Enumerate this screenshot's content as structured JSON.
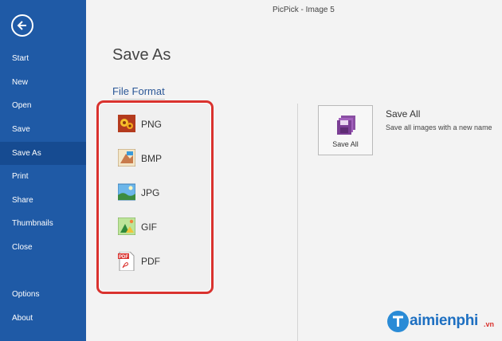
{
  "window": {
    "title": "PicPick - Image 5"
  },
  "sidebar": {
    "items": [
      {
        "label": "Start"
      },
      {
        "label": "New"
      },
      {
        "label": "Open"
      },
      {
        "label": "Save"
      },
      {
        "label": "Save As",
        "active": true
      },
      {
        "label": "Print"
      },
      {
        "label": "Share"
      },
      {
        "label": "Thumbnails"
      },
      {
        "label": "Close"
      },
      {
        "label": "Options"
      },
      {
        "label": "About"
      }
    ]
  },
  "main": {
    "title": "Save As",
    "section_title": "File Format",
    "formats": [
      {
        "label": "PNG",
        "icon": "png-icon"
      },
      {
        "label": "BMP",
        "icon": "bmp-icon"
      },
      {
        "label": "JPG",
        "icon": "jpg-icon"
      },
      {
        "label": "GIF",
        "icon": "gif-icon"
      },
      {
        "label": "PDF",
        "icon": "pdf-icon"
      }
    ],
    "save_all": {
      "button_label": "Save All",
      "title": "Save All",
      "description": "Save all images with a new name"
    }
  },
  "watermark": {
    "text": "aimienphi",
    "suffix": ".vn"
  },
  "colors": {
    "sidebar": "#1f5aa6",
    "highlight_border": "#d9322e",
    "accent_text": "#2b5797"
  }
}
